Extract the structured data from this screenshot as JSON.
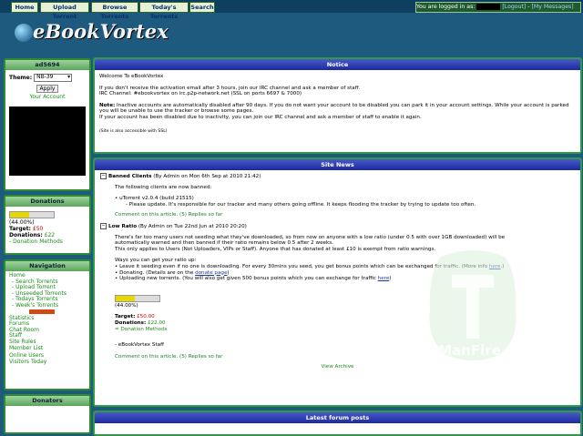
{
  "nav": {
    "home": "Home",
    "upload": "Upload Torrent",
    "browse": "Browse Torrents",
    "today": "Today's Torrents",
    "search": "Search"
  },
  "userbar": {
    "logged_in_as": "You are logged in as:",
    "logout": "[Logout]",
    "sep": "-",
    "messages": "[My Messages]"
  },
  "logo": {
    "text": "eBookVortex"
  },
  "user_panel": {
    "username": "ad5694",
    "theme_label": "Theme:",
    "theme_value": "NB-39",
    "apply": "Apply",
    "your_account": "Your Account"
  },
  "donations_panel": {
    "title": "Donations",
    "percent_text": "(44.00%)",
    "progress": 0.44,
    "target_label": "Target:",
    "target_value": "£50",
    "donations_label": "Donations:",
    "donations_value": "£22",
    "methods": "- Donation Methods"
  },
  "navigation_panel": {
    "title": "Navigation",
    "items": [
      "Home",
      "- Search Torrents",
      "- Upload Torrent",
      "- Unseeded Torrents",
      "- Todays Torrents",
      "- Week's Torrents"
    ],
    "items2": [
      "Statistics",
      "Forums",
      "Chat Room",
      "Staff",
      "Site Rules",
      "Member List"
    ],
    "items3": [
      "Online Users",
      "Visitors Today"
    ]
  },
  "donators_panel": {
    "title": "Donators"
  },
  "notice": {
    "title": "Notice",
    "welcome": "Welcome To eBookVortex",
    "line1": "If you don't receive the activation email after 3 hours, join our IRC channel and ask a member of staff.",
    "line2": "IRC Channel: #ebookvortex on irc.p2p-network.net (SSL on ports 6697 & 7000)",
    "note_label": "Note:",
    "note1": "Inactive accounts are automatically disabled after 90 days. If you do not want your account to be disabled you can park it in your account settings. While your account is parked",
    "note2": "you will be unable to use the tracker or browse some pages.",
    "note3": "If your account has been disabled due to inactivity, you can join our IRC channel and ask a member of staff to enable it again.",
    "ssl": "(Site is also accessible with SSL)"
  },
  "news": {
    "title": "Site News",
    "item1": {
      "title": "Banned Clients",
      "meta": "(By Admin on Mon 6th Sep at 2010 21:42)",
      "intro": "The following clients are now banned:",
      "client": "uTorrent v2.0.4 (build 21515)",
      "client_note": "- Please update. It's responsible for our tracker and many others going offline. It keeps flooding the tracker by trying to update too often.",
      "comment": "Comment on this article. (5) Replies so far"
    },
    "item2": {
      "title": "Low Ratio",
      "meta": "(By Admin on Tue 22nd Jun at 2010 20:20)",
      "p1": "There's far too many users not seeding what they've downloaded, so from now on anyone with a low ratio (under 0.5 with over 1GB downloaded) will be",
      "p2": "automatically warned and then banned if their ratio remains below 0.5 after 2 weeks.",
      "p3": "This only applies to Users (Not Uploaders, VIPs or Staff). Anyone that has donated at least £10 is exempt from ratio warnings.",
      "ways": "Ways you can get your ratio up:",
      "b1": "Leave it seeding even if no one is downloading. For every 30mins you seed, you get bonus points which can be exchanged for traffic. (More info ",
      "b1_link": "here",
      "b1_end": ".)",
      "b2": "Donating. (Details are on the ",
      "b2_link": "donate page",
      "b2_end": ")",
      "b3": "Uploading new torrents. (You will also get given 500 bonus points which you can exchange for traffic ",
      "b3_link": "here",
      "b3_end": ")",
      "percent_text": "(44.00%)",
      "progress": 0.44,
      "target_label": "Target:",
      "target_value": "£50.00",
      "donations_label": "Donations:",
      "donations_value": "£22.00",
      "methods": "= Donation Methods",
      "signoff": "- eBookVortex Staff",
      "comment": "Comment on this article. (5) Replies so far"
    },
    "archive": "View Archive"
  },
  "forum": {
    "title": "Latest forum posts"
  },
  "watermark": {
    "line1": "TheManFire",
    "line2": "TorrentAcademy"
  }
}
